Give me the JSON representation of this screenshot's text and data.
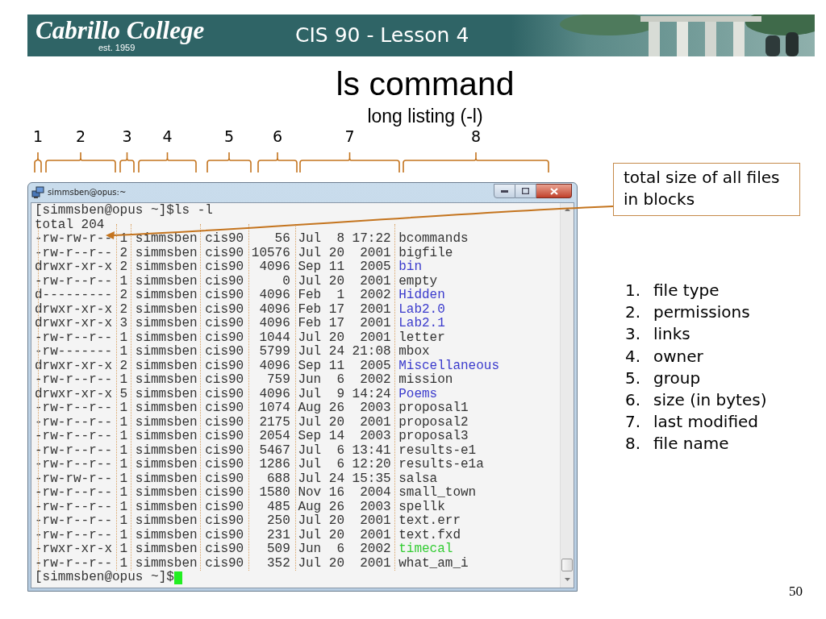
{
  "header": {
    "logo": "Cabrillo College",
    "logo_subtitle": "est. 1959",
    "course": "CIS 90 - Lesson 4"
  },
  "title": "ls command",
  "subtitle": "long listing (-l)",
  "column_markers": [
    "1",
    "2",
    "3",
    "4",
    "5",
    "6",
    "7",
    "8"
  ],
  "terminal": {
    "title": "simmsben@opus:~",
    "command_line": "[simmsben@opus ~]$ls -l",
    "total": "total 204",
    "rows": [
      {
        "perms": "-rw-rw-r--",
        "links": "1",
        "owner": "simmsben",
        "group": "cis90",
        "size": "56",
        "date": "Jul  8 17:22",
        "name": "bcommands",
        "color": "#333333"
      },
      {
        "perms": "-rw-r--r--",
        "links": "2",
        "owner": "simmsben",
        "group": "cis90",
        "size": "10576",
        "date": "Jul 20  2001",
        "name": "bigfile",
        "color": "#333333"
      },
      {
        "perms": "drwxr-xr-x",
        "links": "2",
        "owner": "simmsben",
        "group": "cis90",
        "size": "4096",
        "date": "Sep 11  2005",
        "name": "bin",
        "color": "#3a3acc"
      },
      {
        "perms": "-rw-r--r--",
        "links": "1",
        "owner": "simmsben",
        "group": "cis90",
        "size": "0",
        "date": "Jul 20  2001",
        "name": "empty",
        "color": "#333333"
      },
      {
        "perms": "d---------",
        "links": "2",
        "owner": "simmsben",
        "group": "cis90",
        "size": "4096",
        "date": "Feb  1  2002",
        "name": "Hidden",
        "color": "#3a3acc"
      },
      {
        "perms": "drwxr-xr-x",
        "links": "2",
        "owner": "simmsben",
        "group": "cis90",
        "size": "4096",
        "date": "Feb 17  2001",
        "name": "Lab2.0",
        "color": "#3a3acc"
      },
      {
        "perms": "drwxr-xr-x",
        "links": "3",
        "owner": "simmsben",
        "group": "cis90",
        "size": "4096",
        "date": "Feb 17  2001",
        "name": "Lab2.1",
        "color": "#3a3acc"
      },
      {
        "perms": "-rw-r--r--",
        "links": "1",
        "owner": "simmsben",
        "group": "cis90",
        "size": "1044",
        "date": "Jul 20  2001",
        "name": "letter",
        "color": "#333333"
      },
      {
        "perms": "-rw-------",
        "links": "1",
        "owner": "simmsben",
        "group": "cis90",
        "size": "5799",
        "date": "Jul 24 21:08",
        "name": "mbox",
        "color": "#333333"
      },
      {
        "perms": "drwxr-xr-x",
        "links": "2",
        "owner": "simmsben",
        "group": "cis90",
        "size": "4096",
        "date": "Sep 11  2005",
        "name": "Miscellaneous",
        "color": "#3a3acc"
      },
      {
        "perms": "-rw-r--r--",
        "links": "1",
        "owner": "simmsben",
        "group": "cis90",
        "size": "759",
        "date": "Jun  6  2002",
        "name": "mission",
        "color": "#333333"
      },
      {
        "perms": "drwxr-xr-x",
        "links": "5",
        "owner": "simmsben",
        "group": "cis90",
        "size": "4096",
        "date": "Jul  9 14:24",
        "name": "Poems",
        "color": "#3a3acc"
      },
      {
        "perms": "-rw-r--r--",
        "links": "1",
        "owner": "simmsben",
        "group": "cis90",
        "size": "1074",
        "date": "Aug 26  2003",
        "name": "proposal1",
        "color": "#333333"
      },
      {
        "perms": "-rw-r--r--",
        "links": "1",
        "owner": "simmsben",
        "group": "cis90",
        "size": "2175",
        "date": "Jul 20  2001",
        "name": "proposal2",
        "color": "#333333"
      },
      {
        "perms": "-rw-r--r--",
        "links": "1",
        "owner": "simmsben",
        "group": "cis90",
        "size": "2054",
        "date": "Sep 14  2003",
        "name": "proposal3",
        "color": "#333333"
      },
      {
        "perms": "-rw-r--r--",
        "links": "1",
        "owner": "simmsben",
        "group": "cis90",
        "size": "5467",
        "date": "Jul  6 13:41",
        "name": "results-e1",
        "color": "#333333"
      },
      {
        "perms": "-rw-r--r--",
        "links": "1",
        "owner": "simmsben",
        "group": "cis90",
        "size": "1286",
        "date": "Jul  6 12:20",
        "name": "results-e1a",
        "color": "#333333"
      },
      {
        "perms": "-rw-rw-r--",
        "links": "1",
        "owner": "simmsben",
        "group": "cis90",
        "size": "688",
        "date": "Jul 24 15:35",
        "name": "salsa",
        "color": "#333333"
      },
      {
        "perms": "-rw-r--r--",
        "links": "1",
        "owner": "simmsben",
        "group": "cis90",
        "size": "1580",
        "date": "Nov 16  2004",
        "name": "small_town",
        "color": "#333333"
      },
      {
        "perms": "-rw-r--r--",
        "links": "1",
        "owner": "simmsben",
        "group": "cis90",
        "size": "485",
        "date": "Aug 26  2003",
        "name": "spellk",
        "color": "#333333"
      },
      {
        "perms": "-rw-r--r--",
        "links": "1",
        "owner": "simmsben",
        "group": "cis90",
        "size": "250",
        "date": "Jul 20  2001",
        "name": "text.err",
        "color": "#333333"
      },
      {
        "perms": "-rw-r--r--",
        "links": "1",
        "owner": "simmsben",
        "group": "cis90",
        "size": "231",
        "date": "Jul 20  2001",
        "name": "text.fxd",
        "color": "#333333"
      },
      {
        "perms": "-rwxr-xr-x",
        "links": "1",
        "owner": "simmsben",
        "group": "cis90",
        "size": "509",
        "date": "Jun  6  2002",
        "name": "timecal",
        "color": "#33cc33"
      },
      {
        "perms": "-rw-r--r--",
        "links": "1",
        "owner": "simmsben",
        "group": "cis90",
        "size": "352",
        "date": "Jul 20  2001",
        "name": "what_am_i",
        "color": "#333333"
      }
    ],
    "prompt": "[simmsben@opus ~]$"
  },
  "callout": "total size of all files in blocks",
  "legend": [
    {
      "number": "1.",
      "label": "file type"
    },
    {
      "number": "2.",
      "label": "permissions"
    },
    {
      "number": "3.",
      "label": "links"
    },
    {
      "number": "4.",
      "label": "owner"
    },
    {
      "number": "5.",
      "label": "group"
    },
    {
      "number": "6.",
      "label": "size (in bytes)"
    },
    {
      "number": "7.",
      "label": "last modified"
    },
    {
      "number": "8.",
      "label": "file name"
    }
  ],
  "page_number": "50"
}
